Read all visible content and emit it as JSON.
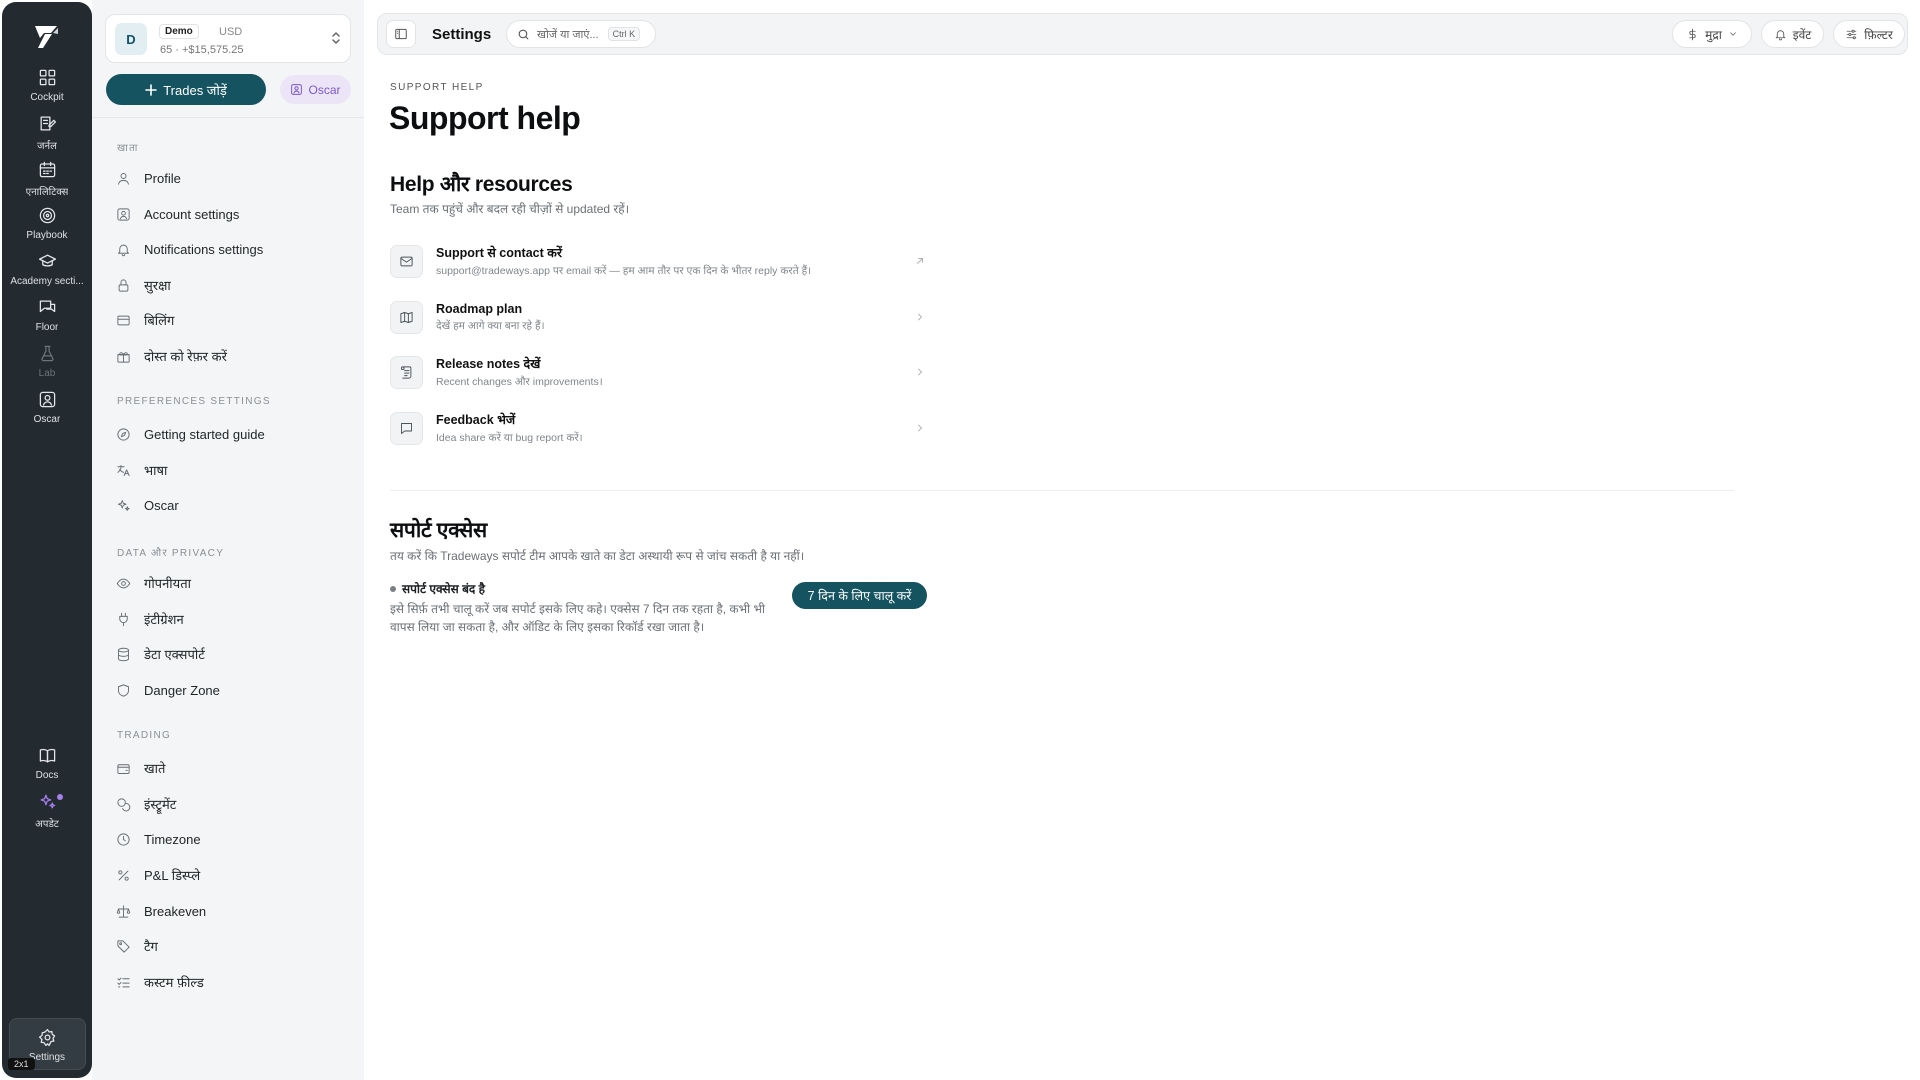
{
  "rail": {
    "items": [
      {
        "label": "Cockpit",
        "icon": "grid-icon"
      },
      {
        "label": "जर्नल",
        "icon": "journal-icon"
      },
      {
        "label": "एनालिटिक्स",
        "icon": "calendar-icon"
      },
      {
        "label": "Playbook",
        "icon": "target-icon"
      },
      {
        "label": "Academy secti...",
        "icon": "graduation-cap-icon"
      },
      {
        "label": "Floor",
        "icon": "chat-icon"
      },
      {
        "label": "Lab",
        "icon": "flask-icon"
      },
      {
        "label": "Oscar",
        "icon": "user-square-icon"
      }
    ],
    "bottom": [
      {
        "label": "Docs",
        "icon": "book-icon"
      },
      {
        "label": "अपडेट",
        "icon": "sparkle-icon"
      },
      {
        "label": "Settings",
        "icon": "gear-icon"
      }
    ],
    "badge": "2x1"
  },
  "account": {
    "avatar": "D",
    "type": "Demo",
    "currency": "USD",
    "summary": "65 · +$15,575.25"
  },
  "add_trades_label": "Trades जोड़ें",
  "oscar_label": "Oscar",
  "sidebar": {
    "sections": [
      {
        "title": "खाता",
        "items": [
          "Profile",
          "Account settings",
          "Notifications settings",
          "सुरक्षा",
          "बिलिंग",
          "दोस्त को रेफ़र करें"
        ]
      },
      {
        "title": "Preferences settings",
        "items": [
          "Getting started guide",
          "भाषा",
          "Oscar"
        ]
      },
      {
        "title": "Data और privacy",
        "items": [
          "गोपनीयता",
          "इंटीग्रेशन",
          "डेटा एक्सपोर्ट",
          "Danger Zone"
        ]
      },
      {
        "title": "Trading",
        "items": [
          "खाते",
          "इंस्ट्रूमेंट",
          "Timezone",
          "P&L डिस्प्ले",
          "Breakeven",
          "टैग",
          "कस्टम फ़ील्ड"
        ]
      }
    ]
  },
  "topbar": {
    "title": "Settings",
    "search_placeholder": "खोजें या जाएं...",
    "search_shortcut": "Ctrl K",
    "currency_label": "मुद्रा",
    "events_label": "इवेंट",
    "filter_label": "फ़िल्टर"
  },
  "page": {
    "eyebrow": "SUPPORT HELP",
    "title": "Support help",
    "help_title": "Help और resources",
    "help_subtitle": "Team तक पहुंचें और बदल रही चीज़ों से updated रहें।",
    "resources": [
      {
        "title": "Support से contact करें",
        "desc": "support@tradeways.app पर email करें — हम आम तौर पर एक दिन के भीतर reply करते हैं।",
        "icon": "mail-icon",
        "action": "external-link-icon"
      },
      {
        "title": "Roadmap plan",
        "desc": "देखें हम आगे क्या बना रहे हैं।",
        "icon": "map-icon",
        "action": "chevron-right-icon"
      },
      {
        "title": "Release notes देखें",
        "desc": "Recent changes और improvements।",
        "icon": "scroll-icon",
        "action": "chevron-right-icon"
      },
      {
        "title": "Feedback भेजें",
        "desc": "Idea share करें या bug report करें।",
        "icon": "message-icon",
        "action": "chevron-right-icon"
      }
    ],
    "support_access": {
      "title": "सपोर्ट एक्सेस",
      "subtitle": "तय करें कि Tradeways सपोर्ट टीम आपके खाते का डेटा अस्थायी रूप से जांच सकती है या नहीं।",
      "status": "सपोर्ट एक्सेस बंद है",
      "description": "इसे सिर्फ़ तभी चालू करें जब सपोर्ट इसके लिए कहे। एक्सेस 7 दिन तक रहता है, कभी भी वापस लिया जा सकता है, और ऑडिट के लिए इसका रिकॉर्ड रखा जाता है।",
      "button": "7 दिन के लिए चालू करें"
    }
  },
  "colors": {
    "rail_bg": "#232a30",
    "sidebar_bg": "#f4f5f6",
    "primary": "#14535f",
    "accent_purple": "#a77ff0"
  }
}
